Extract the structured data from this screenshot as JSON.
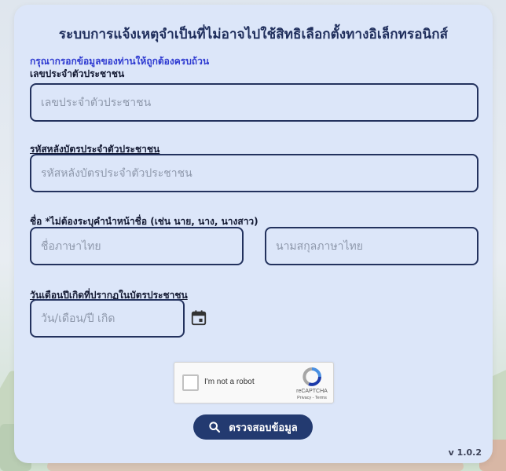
{
  "form": {
    "title": "ระบบการแจ้งเหตุจำเป็นที่ไม่อาจไปใช้สิทธิเลือกตั้งทางอิเล็กทรอนิกส์",
    "notice": "กรุณากรอกข้อมูลของท่านให้ถูกต้องครบถ้วน",
    "id_label": "เลขประจำตัวประชาชน",
    "id_placeholder": "เลขประจำตัวประชาชน",
    "id_value": "",
    "laser_label": "รหัสหลังบัตรประจำตัวประชาชน",
    "laser_placeholder": "รหัสหลังบัตรประจำตัวประชาชน",
    "laser_value": "",
    "name_label": "ชื่อ *ไม่ต้องระบุคำนำหน้าชื่อ (เช่น นาย, นาง, นางสาว)",
    "firstname_placeholder": "ชื่อภาษาไทย",
    "firstname_value": "",
    "lastname_placeholder": "นามสกุลภาษาไทย",
    "lastname_value": "",
    "dob_label": "วันเดือนปีเกิดที่ปรากฏในบัตรประชาชน",
    "dob_placeholder": "วัน/เดือน/ปี เกิด",
    "dob_value": ""
  },
  "captcha": {
    "label": "I'm not a robot",
    "brand": "reCAPTCHA",
    "links": "Privacy - Terms",
    "checked": false
  },
  "submit": {
    "label": "ตรวจสอบข้อมูล",
    "icon": "search-icon"
  },
  "footer": {
    "version": "v 1.0.2"
  },
  "colors": {
    "card": "#dce6f9",
    "accent": "#233a70",
    "notice": "#2f3bd1",
    "border": "#23325e"
  }
}
